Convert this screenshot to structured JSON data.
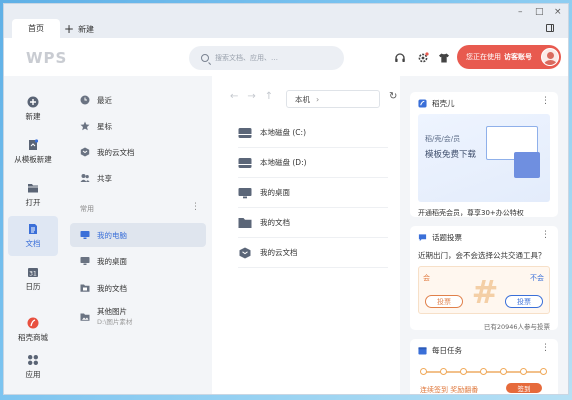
{
  "titlebar": {
    "home_tab": "首页",
    "new_tab": "新建",
    "controls": {
      "minimize": "–",
      "maximize": "□",
      "close": "×"
    }
  },
  "header": {
    "logo": "WPS",
    "search_placeholder": "搜索文档、应用、…",
    "user_status": "您正在使用",
    "user_name": "访客账号"
  },
  "rail": {
    "items": [
      {
        "label": "新建",
        "icon": "plus-circle-icon"
      },
      {
        "label": "从模板新建",
        "icon": "template-icon"
      },
      {
        "label": "打开",
        "icon": "folder-open-icon"
      },
      {
        "label": "文档",
        "icon": "document-icon",
        "active": true
      },
      {
        "label": "日历",
        "icon": "calendar-icon"
      },
      {
        "label": "稻壳商城",
        "icon": "docer-shop-icon"
      },
      {
        "label": "应用",
        "icon": "apps-grid-icon"
      }
    ]
  },
  "nav": {
    "items": [
      {
        "label": "最近",
        "icon": "clock-icon"
      },
      {
        "label": "星标",
        "icon": "star-icon"
      },
      {
        "label": "我的云文档",
        "icon": "cloud-doc-icon"
      },
      {
        "label": "共享",
        "icon": "share-users-icon"
      }
    ],
    "section_label": "常用",
    "common_items": [
      {
        "label": "我的电脑",
        "icon": "computer-icon",
        "active": true
      },
      {
        "label": "我的桌面",
        "icon": "desktop-icon"
      },
      {
        "label": "我的文档",
        "icon": "documents-folder-icon"
      },
      {
        "label": "其他图片",
        "sub": "D:\\图片素材",
        "icon": "pictures-icon"
      }
    ]
  },
  "main": {
    "path": "本机",
    "files": [
      {
        "name": "本地磁盘 (C:)",
        "icon": "disk-icon"
      },
      {
        "name": "本地磁盘 (D:)",
        "icon": "disk-icon"
      },
      {
        "name": "我的桌面",
        "icon": "desktop-icon"
      },
      {
        "name": "我的文档",
        "icon": "folder-icon"
      },
      {
        "name": "我的云文档",
        "icon": "cloud-doc-icon"
      }
    ]
  },
  "side": {
    "docer": {
      "title": "稻壳儿",
      "promo_small": "稻/壳/会/员",
      "promo_big": "模板免费下载",
      "caption": "开通稻壳会员，尊享30+办公特权"
    },
    "topic": {
      "title": "话题投票",
      "question": "近期出门，会不会选择公共交通工具？",
      "yes_label": "会",
      "no_label": "不会",
      "vote_button": "投票",
      "count": "已有20946人参与投票"
    },
    "tasks": {
      "title": "每日任务",
      "text": "连续签到 奖励翻番",
      "button": "签到"
    }
  },
  "colors": {
    "accent_blue": "#3a6fd8",
    "user_pill": "#e85a4f",
    "vote_orange": "#e0804a"
  }
}
